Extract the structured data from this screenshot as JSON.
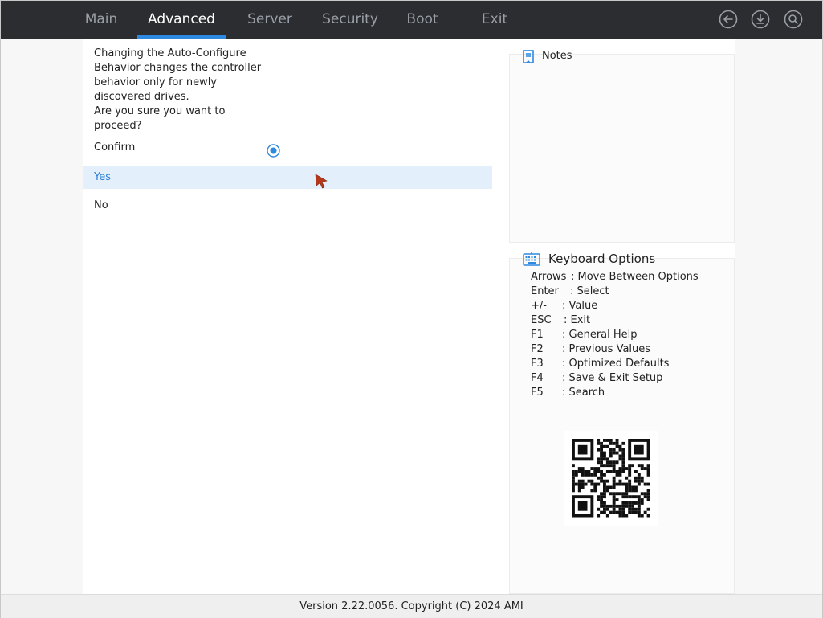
{
  "tabs": [
    {
      "label": "Main",
      "active": false
    },
    {
      "label": "Advanced",
      "active": true
    },
    {
      "label": "Server",
      "active": false
    },
    {
      "label": "Security",
      "active": false
    },
    {
      "label": "Boot",
      "active": false
    },
    {
      "label": "Exit",
      "active": false
    }
  ],
  "toolbar_icons": [
    "back-icon",
    "download-icon",
    "search-icon"
  ],
  "dialog": {
    "prompt": "Changing the Auto-Configure\nBehavior changes the controller\nbehavior only for newly\ndiscovered drives.\n Are you sure you want to\nproceed?",
    "confirm_label": "Confirm",
    "options": [
      {
        "label": "Yes",
        "selected": true
      },
      {
        "label": "No",
        "selected": false
      }
    ]
  },
  "notes": {
    "title": "Notes",
    "icon": "bookmark-icon"
  },
  "keyboard": {
    "title": "Keyboard Options",
    "icon": "keyboard-icon",
    "rows": [
      {
        "key": "Arrows",
        "desc": ": Move Between Options"
      },
      {
        "key": "Enter",
        "desc": ": Select"
      },
      {
        "key": "+/-",
        "desc": ": Value"
      },
      {
        "key": "ESC",
        "desc": ": Exit"
      },
      {
        "key": "F1",
        "desc": ": General Help"
      },
      {
        "key": "F2",
        "desc": ": Previous Values"
      },
      {
        "key": "F3",
        "desc": ": Optimized Defaults"
      },
      {
        "key": "F4",
        "desc": ": Save & Exit Setup"
      },
      {
        "key": "F5",
        "desc": ": Search"
      }
    ]
  },
  "footer": {
    "version": "Version 2.22.0056. Copyright (C) 2024 AMI"
  },
  "colors": {
    "topbar": "#2b2d31",
    "accent": "#2d8ae0",
    "selected_bg": "#e3f0fb",
    "selected_text": "#2d7fd6",
    "cursor": "#b5381a"
  }
}
